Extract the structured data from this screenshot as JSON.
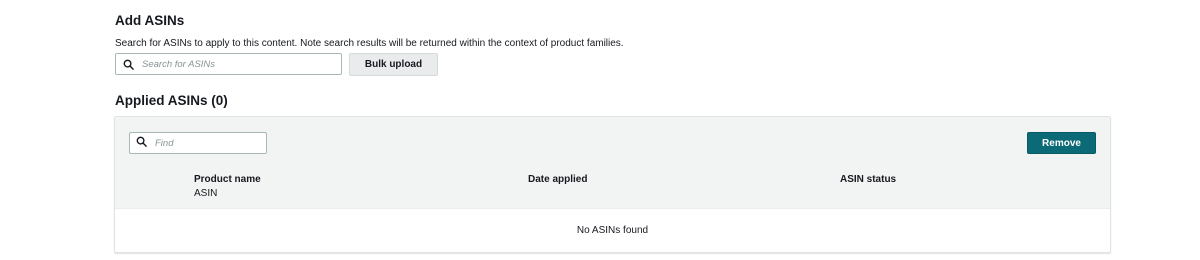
{
  "add_asins": {
    "title": "Add ASINs",
    "description": "Search for ASINs to apply to this content. Note search results will be returned within the context of product families.",
    "search_placeholder": "Search for ASINs",
    "bulk_upload_label": "Bulk upload"
  },
  "applied_asins": {
    "title": "Applied ASINs (0)",
    "find_placeholder": "Find",
    "remove_label": "Remove",
    "columns": {
      "product_name": "Product name",
      "product_name_sub": "ASIN",
      "date_applied": "Date applied",
      "asin_status": "ASIN status"
    },
    "empty_message": "No ASINs found"
  },
  "colors": {
    "primary_button": "#0b6a75",
    "header_bg": "#f2f3f3"
  },
  "icons": {
    "search": "search-icon",
    "find": "search-icon"
  }
}
